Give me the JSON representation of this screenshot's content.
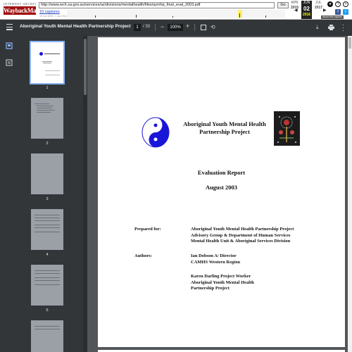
{
  "wayback": {
    "logo_top": "INTERNET ARCHIVE",
    "logo_word": "WaybackMachine",
    "url": "http://www.wch.sa.gov.au/services/az/divisions/mentalhealth/files/aymhp_final_eval_2003.pdf",
    "go_label": "Go",
    "captures_label": "10 captures",
    "date_range": "18 Jun 2008 - 1 Jan 2014",
    "months": [
      {
        "month": "APR",
        "day": "",
        "year": "2015"
      },
      {
        "month": "JUN",
        "day": "02",
        "year": "2016"
      },
      {
        "month": "JUL",
        "day": "",
        "year": "2017"
      }
    ],
    "about_label": "About this capture"
  },
  "pdf_toolbar": {
    "title": "Aboriginal Youth Mental Health Partnership Project",
    "current_page": "1",
    "total_pages": "/ 33",
    "zoom": "100%",
    "zoom_out": "−",
    "zoom_in": "+"
  },
  "thumbnails": [
    {
      "number": "1",
      "selected": true
    },
    {
      "number": "2",
      "selected": false
    },
    {
      "number": "3",
      "selected": false
    },
    {
      "number": "4",
      "selected": false
    },
    {
      "number": "5",
      "selected": false
    }
  ],
  "document": {
    "project_title_line1": "Aboriginal Youth Mental Health",
    "project_title_line2": "Partnership Project",
    "report_title": "Evaluation Report",
    "report_date": "August 2003",
    "prepared_label": "Prepared for:",
    "prepared_lines": [
      "Aboriginal Youth Mental Health Partnership Project",
      "Advisory Group & Department of Human Services",
      "Mental Health Unit & Aboriginal Services Division"
    ],
    "authors_label": "Authors:",
    "author1_lines": [
      "Ian Dobson A/ Director",
      "CAMHS Western Region"
    ],
    "author2_lines": [
      "Karen Darling Project Worker",
      "Aboriginal Youth Mental Health",
      "Partnership Project"
    ]
  },
  "colors": {
    "accent": "#8ab4f8",
    "toolbar": "#323639",
    "viewer_bg": "#525659",
    "logo_blue": "#1a16d8"
  }
}
